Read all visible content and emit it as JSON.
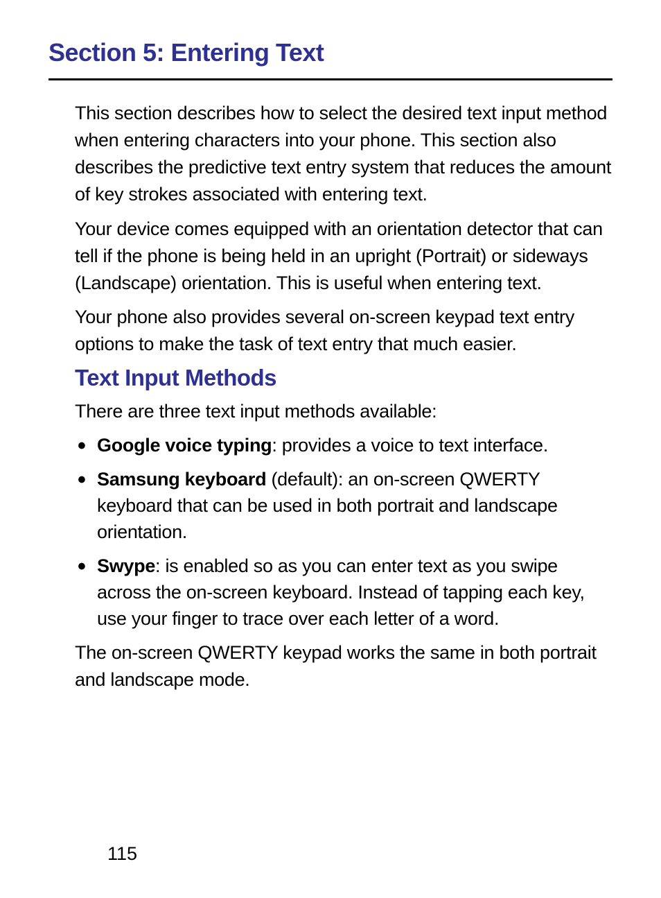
{
  "section": {
    "title": "Section 5: Entering Text"
  },
  "paragraphs": {
    "intro1": "This section describes how to select the desired text input method when entering characters into your phone. This section also describes the predictive text entry system that reduces the amount of key strokes associated with entering text.",
    "intro2": "Your device comes equipped with an orientation detector that can tell if the phone is being held in an upright (Portrait) or sideways (Landscape) orientation. This is useful when entering text.",
    "intro3": "Your phone also provides several on-screen keypad text entry options to make the task of text entry that much easier.",
    "methodsIntro": "There are three text input methods available:",
    "closing": "The on-screen QWERTY keypad works the same in both portrait and landscape mode."
  },
  "subheadings": {
    "methods": "Text Input Methods"
  },
  "bullets": {
    "item1": {
      "bold": "Google voice typing",
      "rest": ": provides a voice to text interface."
    },
    "item2": {
      "bold": "Samsung keyboard",
      "rest": " (default): an on-screen QWERTY keyboard that can be used in both portrait and landscape orientation."
    },
    "item3": {
      "bold": "Swype",
      "rest": ": is enabled so as you can enter text as you swipe across the on-screen keyboard. Instead of tapping each key, use your finger to trace over each letter of a word."
    }
  },
  "pageNumber": "115"
}
